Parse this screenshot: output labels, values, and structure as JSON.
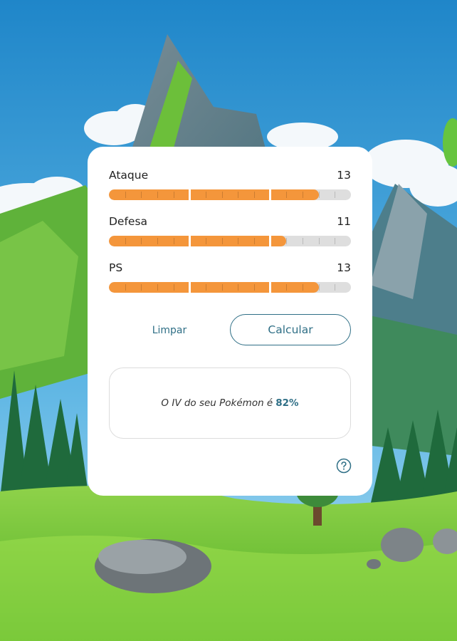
{
  "stats": [
    {
      "label": "Ataque",
      "value": "13",
      "max": 15
    },
    {
      "label": "Defesa",
      "value": "11",
      "max": 15
    },
    {
      "label": "PS",
      "value": "13",
      "max": 15
    }
  ],
  "buttons": {
    "clear_label": "Limpar",
    "calc_label": "Calcular"
  },
  "result": {
    "prefix": "O IV do seu Pokémon é",
    "value": "82%"
  },
  "colors": {
    "fill": "#f4963b",
    "track": "#dedede",
    "accent": "#2f6f86"
  },
  "icons": {
    "help": "question-circle-icon"
  }
}
